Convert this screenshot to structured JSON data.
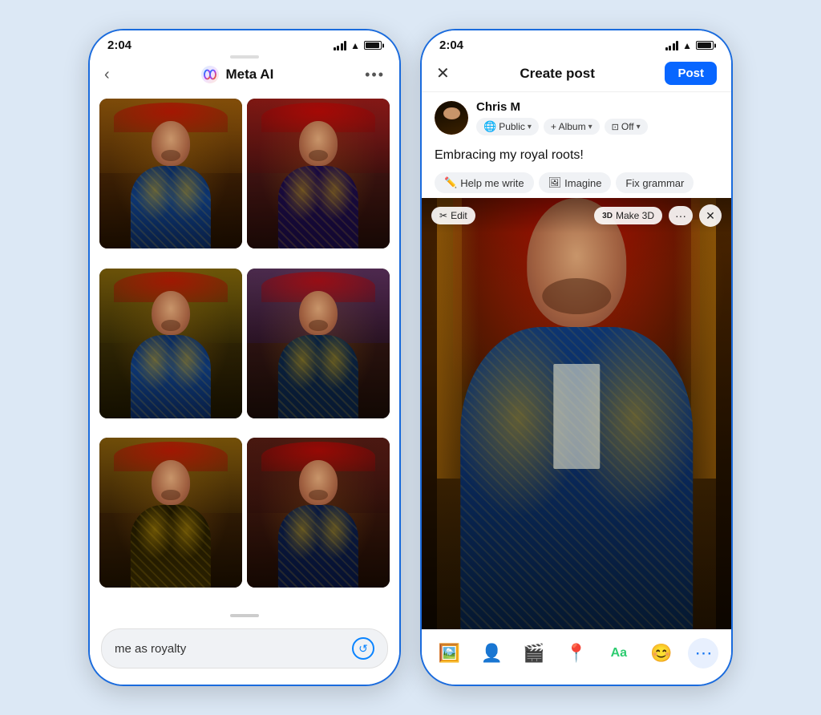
{
  "phone1": {
    "status_time": "2:04",
    "header": {
      "back_label": "‹",
      "title": "Meta AI",
      "more_label": "•••"
    },
    "grid_images": [
      {
        "id": "img1",
        "alt": "royal portrait 1"
      },
      {
        "id": "img2",
        "alt": "royal portrait 2"
      },
      {
        "id": "img3",
        "alt": "royal portrait 3"
      },
      {
        "id": "img4",
        "alt": "royal portrait 4"
      },
      {
        "id": "img5",
        "alt": "royal portrait 5"
      },
      {
        "id": "img6",
        "alt": "royal portrait 6"
      }
    ],
    "input": {
      "value": "me as royalty",
      "placeholder": "me as royalty"
    },
    "refresh_icon": "↺"
  },
  "phone2": {
    "status_time": "2:04",
    "header": {
      "close_label": "✕",
      "title": "Create post",
      "post_label": "Post"
    },
    "user": {
      "name": "Chris M",
      "avatar_alt": "user avatar"
    },
    "audience_pills": [
      {
        "label": "Public",
        "icon": "🌐"
      },
      {
        "label": "+ Album",
        "icon": ""
      },
      {
        "label": "Off",
        "icon": "📷"
      }
    ],
    "post_text": "Embracing my royal roots!",
    "ai_tools": [
      {
        "label": "Help me write",
        "icon": "✏️"
      },
      {
        "label": "Imagine",
        "icon": "🖼"
      },
      {
        "label": "Fix grammar",
        "icon": ""
      }
    ],
    "image_overlay": {
      "edit_label": "Edit",
      "make3d_label": "Make 3D",
      "edit_icon": "✂",
      "threed_icon": "3D"
    },
    "bottom_tools": [
      {
        "name": "photo-video",
        "icon": "🖼",
        "color": "#45bd62"
      },
      {
        "name": "tag-people",
        "icon": "👤",
        "color": "#1877f2"
      },
      {
        "name": "reel",
        "icon": "🎬",
        "color": "#e02020"
      },
      {
        "name": "location",
        "icon": "📍",
        "color": "#e67e22"
      },
      {
        "name": "text-style",
        "icon": "Aa",
        "color": "#2ecc71",
        "is_text": true
      },
      {
        "name": "emoji",
        "icon": "😊",
        "color": "#f1c40f"
      },
      {
        "name": "more",
        "icon": "⋯",
        "color": "#1877f2"
      }
    ]
  }
}
